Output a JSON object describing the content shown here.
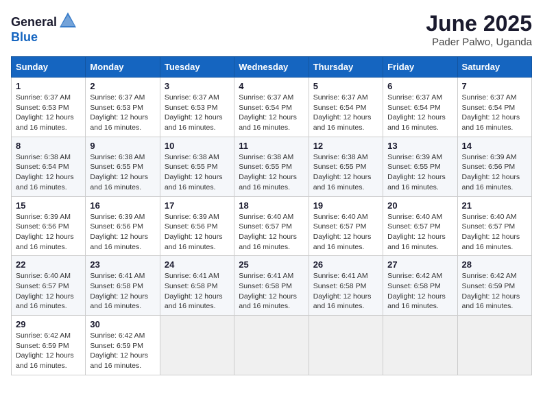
{
  "logo": {
    "text_general": "General",
    "text_blue": "Blue"
  },
  "title": "June 2025",
  "location": "Pader Palwo, Uganda",
  "days_of_week": [
    "Sunday",
    "Monday",
    "Tuesday",
    "Wednesday",
    "Thursday",
    "Friday",
    "Saturday"
  ],
  "weeks": [
    [
      {
        "day": "1",
        "sunrise": "6:37 AM",
        "sunset": "6:53 PM",
        "daylight": "12 hours and 16 minutes."
      },
      {
        "day": "2",
        "sunrise": "6:37 AM",
        "sunset": "6:53 PM",
        "daylight": "12 hours and 16 minutes."
      },
      {
        "day": "3",
        "sunrise": "6:37 AM",
        "sunset": "6:53 PM",
        "daylight": "12 hours and 16 minutes."
      },
      {
        "day": "4",
        "sunrise": "6:37 AM",
        "sunset": "6:54 PM",
        "daylight": "12 hours and 16 minutes."
      },
      {
        "day": "5",
        "sunrise": "6:37 AM",
        "sunset": "6:54 PM",
        "daylight": "12 hours and 16 minutes."
      },
      {
        "day": "6",
        "sunrise": "6:37 AM",
        "sunset": "6:54 PM",
        "daylight": "12 hours and 16 minutes."
      },
      {
        "day": "7",
        "sunrise": "6:37 AM",
        "sunset": "6:54 PM",
        "daylight": "12 hours and 16 minutes."
      }
    ],
    [
      {
        "day": "8",
        "sunrise": "6:38 AM",
        "sunset": "6:54 PM",
        "daylight": "12 hours and 16 minutes."
      },
      {
        "day": "9",
        "sunrise": "6:38 AM",
        "sunset": "6:55 PM",
        "daylight": "12 hours and 16 minutes."
      },
      {
        "day": "10",
        "sunrise": "6:38 AM",
        "sunset": "6:55 PM",
        "daylight": "12 hours and 16 minutes."
      },
      {
        "day": "11",
        "sunrise": "6:38 AM",
        "sunset": "6:55 PM",
        "daylight": "12 hours and 16 minutes."
      },
      {
        "day": "12",
        "sunrise": "6:38 AM",
        "sunset": "6:55 PM",
        "daylight": "12 hours and 16 minutes."
      },
      {
        "day": "13",
        "sunrise": "6:39 AM",
        "sunset": "6:55 PM",
        "daylight": "12 hours and 16 minutes."
      },
      {
        "day": "14",
        "sunrise": "6:39 AM",
        "sunset": "6:56 PM",
        "daylight": "12 hours and 16 minutes."
      }
    ],
    [
      {
        "day": "15",
        "sunrise": "6:39 AM",
        "sunset": "6:56 PM",
        "daylight": "12 hours and 16 minutes."
      },
      {
        "day": "16",
        "sunrise": "6:39 AM",
        "sunset": "6:56 PM",
        "daylight": "12 hours and 16 minutes."
      },
      {
        "day": "17",
        "sunrise": "6:39 AM",
        "sunset": "6:56 PM",
        "daylight": "12 hours and 16 minutes."
      },
      {
        "day": "18",
        "sunrise": "6:40 AM",
        "sunset": "6:57 PM",
        "daylight": "12 hours and 16 minutes."
      },
      {
        "day": "19",
        "sunrise": "6:40 AM",
        "sunset": "6:57 PM",
        "daylight": "12 hours and 16 minutes."
      },
      {
        "day": "20",
        "sunrise": "6:40 AM",
        "sunset": "6:57 PM",
        "daylight": "12 hours and 16 minutes."
      },
      {
        "day": "21",
        "sunrise": "6:40 AM",
        "sunset": "6:57 PM",
        "daylight": "12 hours and 16 minutes."
      }
    ],
    [
      {
        "day": "22",
        "sunrise": "6:40 AM",
        "sunset": "6:57 PM",
        "daylight": "12 hours and 16 minutes."
      },
      {
        "day": "23",
        "sunrise": "6:41 AM",
        "sunset": "6:58 PM",
        "daylight": "12 hours and 16 minutes."
      },
      {
        "day": "24",
        "sunrise": "6:41 AM",
        "sunset": "6:58 PM",
        "daylight": "12 hours and 16 minutes."
      },
      {
        "day": "25",
        "sunrise": "6:41 AM",
        "sunset": "6:58 PM",
        "daylight": "12 hours and 16 minutes."
      },
      {
        "day": "26",
        "sunrise": "6:41 AM",
        "sunset": "6:58 PM",
        "daylight": "12 hours and 16 minutes."
      },
      {
        "day": "27",
        "sunrise": "6:42 AM",
        "sunset": "6:58 PM",
        "daylight": "12 hours and 16 minutes."
      },
      {
        "day": "28",
        "sunrise": "6:42 AM",
        "sunset": "6:59 PM",
        "daylight": "12 hours and 16 minutes."
      }
    ],
    [
      {
        "day": "29",
        "sunrise": "6:42 AM",
        "sunset": "6:59 PM",
        "daylight": "12 hours and 16 minutes."
      },
      {
        "day": "30",
        "sunrise": "6:42 AM",
        "sunset": "6:59 PM",
        "daylight": "12 hours and 16 minutes."
      },
      null,
      null,
      null,
      null,
      null
    ]
  ]
}
